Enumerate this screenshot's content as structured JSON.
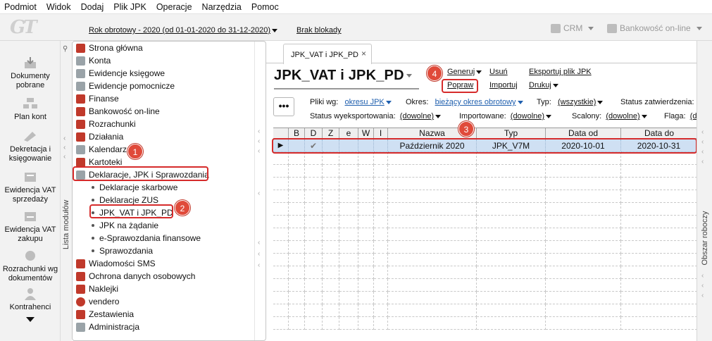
{
  "menubar": [
    "Podmiot",
    "Widok",
    "Dodaj",
    "Plik JPK",
    "Operacje",
    "Narzędzia",
    "Pomoc"
  ],
  "toolbar": {
    "logo": "GT",
    "year_label": "Rok obrotowy - 2020  (od 01-01-2020 do 31-12-2020)",
    "brak_blokady": "Brak blokady",
    "crm": "CRM",
    "bankowosc": "Bankowość on-line"
  },
  "leftbar": [
    {
      "label": "Dokumenty pobrane",
      "icon": "download-documents-icon"
    },
    {
      "label": "Plan kont",
      "icon": "chart-of-accounts-icon"
    },
    {
      "label": "Dekretacja i księgowanie",
      "icon": "booking-icon"
    },
    {
      "label": "Ewidencja VAT sprzedaży",
      "icon": "vat-sales-icon"
    },
    {
      "label": "Ewidencja VAT zakupu",
      "icon": "vat-purchase-icon"
    },
    {
      "label": "Rozrachunki wg dokumentów",
      "icon": "settlements-icon"
    },
    {
      "label": "Kontrahenci",
      "icon": "contractors-icon"
    }
  ],
  "module_strip_label": "Lista modułów",
  "tree": {
    "items": [
      {
        "label": "Strona główna",
        "icon_color": "#c0392b"
      },
      {
        "label": "Konta",
        "icon_color": "#7f8c8d"
      },
      {
        "label": "Ewidencje księgowe",
        "icon_color": "#7f8c8d"
      },
      {
        "label": "Ewidencje pomocnicze",
        "icon_color": "#7f8c8d"
      },
      {
        "label": "Finanse",
        "icon_color": "#c0392b"
      },
      {
        "label": "Bankowość on-line",
        "icon_color": "#c0392b"
      },
      {
        "label": "Rozrachunki",
        "icon_color": "#c0392b"
      },
      {
        "label": "Działania",
        "icon_color": "#c0392b"
      },
      {
        "label": "Kalendarz",
        "icon_color": "#7f8c8d"
      },
      {
        "label": "Kartoteki",
        "icon_color": "#c0392b"
      },
      {
        "label": "Deklaracje, JPK i Sprawozdania",
        "icon_color": "#7f8c8d"
      }
    ],
    "subitems": [
      "Deklaracje skarbowe",
      "Deklaracje ZUS",
      "JPK_VAT i JPK_PD",
      "JPK na żądanie",
      "e-Sprawozdania finansowe",
      "Sprawozdania"
    ],
    "items_after": [
      {
        "label": "Wiadomości SMS",
        "icon_color": "#c0392b"
      },
      {
        "label": "Ochrona danych osobowych",
        "icon_color": "#c0392b"
      },
      {
        "label": "Naklejki",
        "icon_color": "#c0392b"
      },
      {
        "label": "vendero",
        "icon_color": "#c0392b"
      },
      {
        "label": "Zestawienia",
        "icon_color": "#c0392b"
      },
      {
        "label": "Administracja",
        "icon_color": "#7f8c8d"
      }
    ]
  },
  "tab": {
    "label": "JPK_VAT i JPK_PD",
    "close": "×"
  },
  "page_title": "JPK_VAT i JPK_PD",
  "actions": {
    "generuj": "Generuj",
    "usun": "Usuń",
    "eksportuj": "Eksportuj plik JPK",
    "popraw": "Popraw",
    "importuj": "Importuj",
    "drukuj": "Drukuj"
  },
  "more_button": "•••",
  "filters": {
    "pliki_label": "Pliki wg:",
    "pliki_value": "okresu JPK",
    "okres_label": "Okres:",
    "okres_value": "bieżący okres obrotowy",
    "typ_label": "Typ:",
    "typ_value": "(wszystkie)",
    "status_zatw_label": "Status zatwierdzenia:",
    "status_wyeks_label": "Status wyeksportowania:",
    "status_wyeks_value": "(dowolne)",
    "importowane_label": "Importowane:",
    "importowane_value": "(dowolne)",
    "scalony_label": "Scalony:",
    "scalony_value": "(dowolne)",
    "flaga_label": "Flaga:",
    "flaga_value": "(d"
  },
  "grid": {
    "columns": [
      "",
      "B",
      "D",
      "Z",
      "e",
      "W",
      "I",
      "Nazwa",
      "Typ",
      "Data od",
      "Data do"
    ],
    "rows": [
      {
        "marker": "▶",
        "d_check": "✔",
        "nazwa": "Październik 2020",
        "typ": "JPK_V7M",
        "data_od": "2020-10-01",
        "data_do": "2020-10-31"
      }
    ]
  },
  "right_strip_label": "Obszar roboczy",
  "annotations": [
    "1",
    "2",
    "3",
    "4"
  ],
  "colors": {
    "highlight": "#d62b2b",
    "badge": "#e04a3a",
    "selected_row": "#cfe0f3",
    "link_blue": "#1f5fae"
  }
}
